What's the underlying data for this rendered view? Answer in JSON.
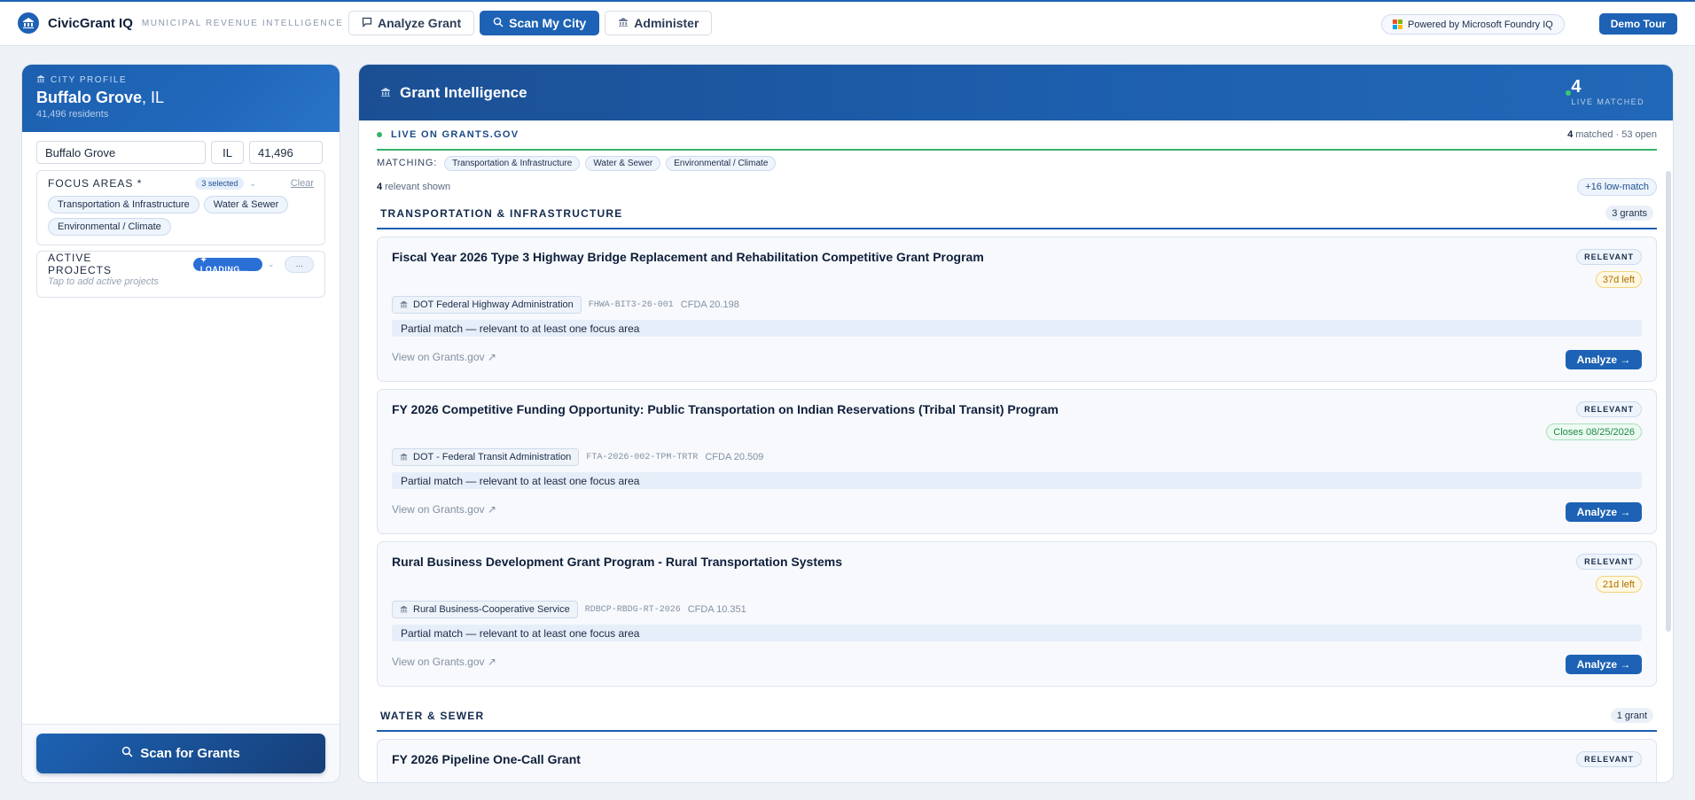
{
  "topbar": {
    "app_name": "CivicGrant IQ",
    "tagline": "MUNICIPAL REVENUE INTELLIGENCE",
    "nav": [
      {
        "label": "Analyze Grant",
        "icon": "chat-bubble-icon",
        "active": false
      },
      {
        "label": "Scan My City",
        "icon": "search-icon",
        "active": true
      },
      {
        "label": "Administer",
        "icon": "bank-icon",
        "active": false
      }
    ],
    "powered_by": "Powered by Microsoft Foundry IQ",
    "demo_tour": "Demo Tour"
  },
  "colors": {
    "accent": "#1d62b4",
    "live_green": "#37b368",
    "warn": "#b06d00",
    "ok": "#1f8a49"
  },
  "sidebar": {
    "profile_label": "CITY PROFILE",
    "city_bold": "Buffalo Grove",
    "city_state": ", IL",
    "residents": "41,496 residents",
    "inputs": {
      "city": "Buffalo Grove",
      "state": "IL",
      "population": "41,496"
    },
    "focus": {
      "title": "FOCUS AREAS *",
      "selected": "3 selected",
      "clear": "Clear",
      "chips": [
        "Transportation & Infrastructure",
        "Water & Sewer",
        "Environmental / Climate"
      ]
    },
    "projects": {
      "title": "ACTIVE PROJECTS",
      "loading": "✦ LOADING...",
      "more": "...",
      "hint": "Tap to add active projects"
    },
    "scan_button": "Scan for Grants"
  },
  "main": {
    "title": "Grant Intelligence",
    "live_count": "4",
    "live_label": "LIVE MATCHED",
    "source_label": "LIVE ON GRANTS.GOV",
    "matched_count": "4",
    "matched_rest": "matched · 53 open",
    "matching_label": "MATCHING:",
    "matching_chips": [
      "Transportation & Infrastructure",
      "Water & Sewer",
      "Environmental / Climate"
    ],
    "shown_count": "4",
    "shown_rest": "relevant shown",
    "low_match": "+16 low-match",
    "categories": [
      {
        "name": "TRANSPORTATION & INFRASTRUCTURE",
        "count": "3 grants",
        "grants": [
          {
            "title": "Fiscal Year 2026 Type 3 Highway Bridge Replacement and Rehabilitation Competitive Grant Program",
            "status": "RELEVANT",
            "due": "37d left",
            "agency": "DOT Federal Highway Administration",
            "code": "FHWA-BIT3-26-001",
            "cfda": "CFDA 20.198",
            "match_note": "Partial match — relevant to at least one focus area",
            "view_link": "View on Grants.gov ↗",
            "analyze": "Analyze →"
          },
          {
            "title": "FY 2026 Competitive Funding Opportunity: Public Transportation on Indian Reservations (Tribal Transit) Program",
            "status": "RELEVANT",
            "due": "Closes 08/25/2026",
            "agency": "DOT - Federal Transit Administration",
            "code": "FTA-2026-002-TPM-TRTR",
            "cfda": "CFDA 20.509",
            "match_note": "Partial match — relevant to at least one focus area",
            "view_link": "View on Grants.gov ↗",
            "analyze": "Analyze →"
          },
          {
            "title": "Rural Business Development Grant Program - Rural Transportation Systems",
            "status": "RELEVANT",
            "due": "21d left",
            "agency": "Rural Business-Cooperative Service",
            "code": "RDBCP-RBDG-RT-2026",
            "cfda": "CFDA 10.351",
            "match_note": "Partial match — relevant to at least one focus area",
            "view_link": "View on Grants.gov ↗",
            "analyze": "Analyze →"
          }
        ]
      },
      {
        "name": "WATER & SEWER",
        "count": "1 grant",
        "grants": [
          {
            "title": "FY 2026 Pipeline One-Call Grant",
            "status": "RELEVANT"
          }
        ]
      }
    ]
  }
}
